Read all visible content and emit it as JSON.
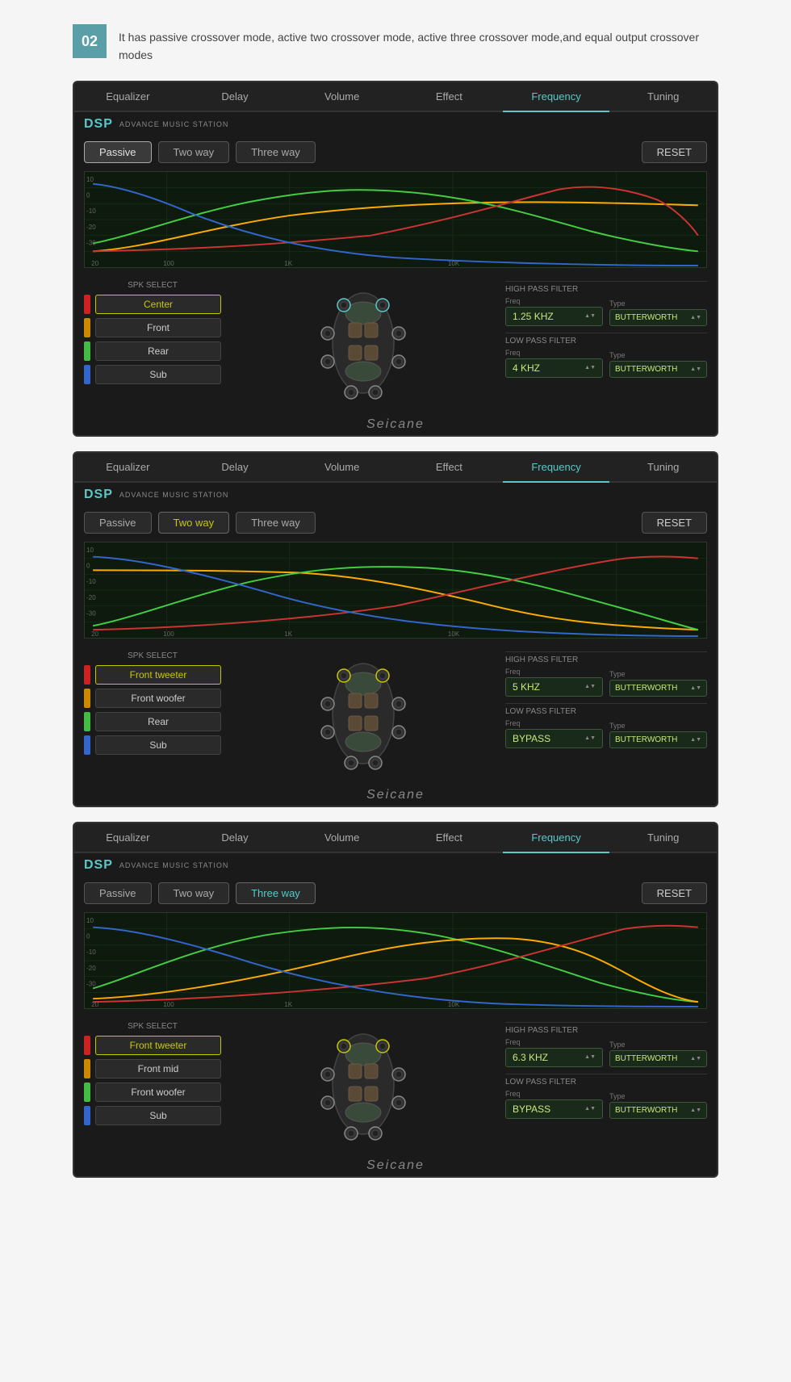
{
  "header": {
    "step": "02",
    "description": "It has passive crossover mode, active two crossover mode, active three crossover mode,and equal output crossover modes"
  },
  "panels": [
    {
      "id": "panel1",
      "tabs": [
        "Equalizer",
        "Delay",
        "Volume",
        "Effect",
        "Frequency",
        "Tuning"
      ],
      "active_tab": "Frequency",
      "dsp_logo": "DSP",
      "dsp_subtitle": "ADVANCE MUSIC STATION",
      "modes": [
        "Passive",
        "Two way",
        "Three way"
      ],
      "active_mode": "Passive",
      "reset_label": "RESET",
      "spk_title": "SPK SELECT",
      "spk_items": [
        {
          "color": "#cc2222",
          "label": "Center",
          "selected": true,
          "style": "yellow"
        },
        {
          "color": "#cc8800",
          "label": "Front",
          "selected": false
        },
        {
          "color": "#44bb44",
          "label": "Rear",
          "selected": false
        },
        {
          "color": "#3366cc",
          "label": "Sub",
          "selected": false
        }
      ],
      "high_pass": {
        "title": "HIGH PASS FILTER",
        "freq_label": "Freq",
        "freq_value": "1.25 KHZ",
        "type_label": "Type",
        "type_value": "BUTTERWORTH"
      },
      "low_pass": {
        "title": "LOW PASS FILTER",
        "freq_label": "Freq",
        "freq_value": "4 KHZ",
        "type_label": "Type",
        "type_value": "BUTTERWORTH"
      },
      "seicane": "Seicane",
      "chart": {
        "curves": [
          {
            "color": "#ffaa00",
            "type": "green-rise"
          },
          {
            "color": "#44cc44",
            "type": "mid-bell"
          },
          {
            "color": "#cc2222",
            "type": "high-fall"
          },
          {
            "color": "#3366cc",
            "type": "low-fall"
          }
        ]
      }
    },
    {
      "id": "panel2",
      "tabs": [
        "Equalizer",
        "Delay",
        "Volume",
        "Effect",
        "Frequency",
        "Tuning"
      ],
      "active_tab": "Frequency",
      "dsp_logo": "DSP",
      "dsp_subtitle": "ADVANCE MUSIC STATION",
      "modes": [
        "Passive",
        "Two way",
        "Three way"
      ],
      "active_mode": "Two way",
      "reset_label": "RESET",
      "spk_title": "SPK SELECT",
      "spk_items": [
        {
          "color": "#cc2222",
          "label": "Front tweeter",
          "selected": true,
          "style": "yellow"
        },
        {
          "color": "#cc8800",
          "label": "Front woofer",
          "selected": false
        },
        {
          "color": "#44bb44",
          "label": "Rear",
          "selected": false
        },
        {
          "color": "#3366cc",
          "label": "Sub",
          "selected": false
        }
      ],
      "high_pass": {
        "title": "HIGH PASS FILTER",
        "freq_label": "Freq",
        "freq_value": "5 KHZ",
        "type_label": "Type",
        "type_value": "BUTTERWORTH"
      },
      "low_pass": {
        "title": "LOW PASS FILTER",
        "freq_label": "Freq",
        "freq_value": "BYPASS",
        "type_label": "Type",
        "type_value": "BUTTERWORTH"
      },
      "seicane": "Seicane",
      "chart": {
        "curves": []
      }
    },
    {
      "id": "panel3",
      "tabs": [
        "Equalizer",
        "Delay",
        "Volume",
        "Effect",
        "Frequency",
        "Tuning"
      ],
      "active_tab": "Frequency",
      "dsp_logo": "DSP",
      "dsp_subtitle": "ADVANCE MUSIC STATION",
      "modes": [
        "Passive",
        "Two way",
        "Three way"
      ],
      "active_mode": "Three way",
      "reset_label": "RESET",
      "spk_title": "SPK SELECT",
      "spk_items": [
        {
          "color": "#cc2222",
          "label": "Front tweeter",
          "selected": true,
          "style": "yellow"
        },
        {
          "color": "#cc8800",
          "label": "Front mid",
          "selected": false
        },
        {
          "color": "#44bb44",
          "label": "Front woofer",
          "selected": false
        },
        {
          "color": "#3366cc",
          "label": "Sub",
          "selected": false
        }
      ],
      "high_pass": {
        "title": "HIGH PASS FILTER",
        "freq_label": "Freq",
        "freq_value": "6.3 KHZ",
        "type_label": "Type",
        "type_value": "BUTTERWORTH"
      },
      "low_pass": {
        "title": "LOW PASS FILTER",
        "freq_label": "Freq",
        "freq_value": "BYPASS",
        "type_label": "Type",
        "type_value": "BUTTERWORTH"
      },
      "seicane": "Seicane",
      "chart": {
        "curves": []
      }
    }
  ]
}
